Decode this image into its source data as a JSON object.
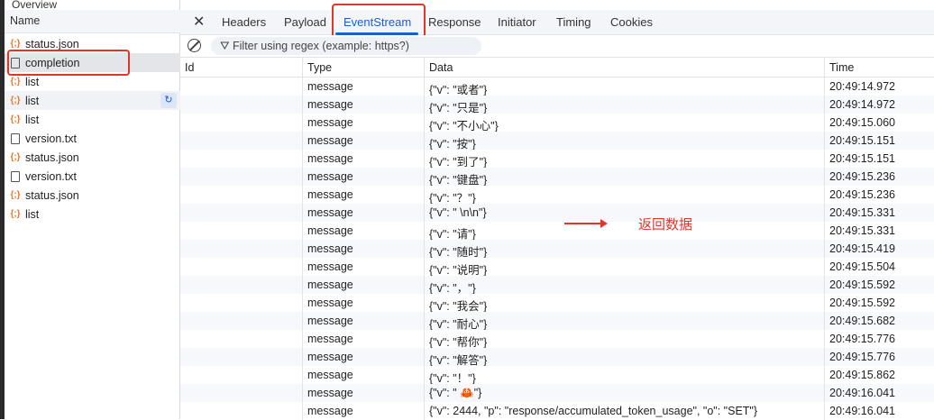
{
  "left": {
    "overview": "Overview",
    "name_header": "Name",
    "items": [
      {
        "label": "status.json",
        "icon": "json-icon"
      },
      {
        "label": "completion",
        "icon": "document-icon"
      },
      {
        "label": "list",
        "icon": "json-icon"
      },
      {
        "label": "list",
        "icon": "json-icon"
      },
      {
        "label": "list",
        "icon": "json-icon"
      },
      {
        "label": "version.txt",
        "icon": "document-icon"
      },
      {
        "label": "status.json",
        "icon": "json-icon"
      },
      {
        "label": "version.txt",
        "icon": "document-icon"
      },
      {
        "label": "status.json",
        "icon": "json-icon"
      },
      {
        "label": "list",
        "icon": "json-icon"
      }
    ]
  },
  "tabs": [
    "Headers",
    "Payload",
    "EventStream",
    "Response",
    "Initiator",
    "Timing",
    "Cookies"
  ],
  "active_tab": "EventStream",
  "filter_placeholder": "Filter using regex (example: https?)",
  "columns": [
    "Id",
    "Type",
    "Data",
    "Time"
  ],
  "rows": [
    [
      "",
      "message",
      "{\"v\": \"或者\"}",
      "20:49:14.972"
    ],
    [
      "",
      "message",
      "{\"v\": \"只是\"}",
      "20:49:14.972"
    ],
    [
      "",
      "message",
      "{\"v\": \"不小心\"}",
      "20:49:15.060"
    ],
    [
      "",
      "message",
      "{\"v\": \"按\"}",
      "20:49:15.151"
    ],
    [
      "",
      "message",
      "{\"v\": \"到了\"}",
      "20:49:15.151"
    ],
    [
      "",
      "message",
      "{\"v\": \"键盘\"}",
      "20:49:15.236"
    ],
    [
      "",
      "message",
      "{\"v\": \"？\"}",
      "20:49:15.236"
    ],
    [
      "",
      "message",
      "{\"v\": \" \\n\\n\"}",
      "20:49:15.331"
    ],
    [
      "",
      "message",
      "{\"v\": \"请\"}",
      "20:49:15.331"
    ],
    [
      "",
      "message",
      "{\"v\": \"随时\"}",
      "20:49:15.419"
    ],
    [
      "",
      "message",
      "{\"v\": \"说明\"}",
      "20:49:15.504"
    ],
    [
      "",
      "message",
      "{\"v\": \"，\"}",
      "20:49:15.592"
    ],
    [
      "",
      "message",
      "{\"v\": \"我会\"}",
      "20:49:15.592"
    ],
    [
      "",
      "message",
      "{\"v\": \"耐心\"}",
      "20:49:15.682"
    ],
    [
      "",
      "message",
      "{\"v\": \"帮你\"}",
      "20:49:15.776"
    ],
    [
      "",
      "message",
      "{\"v\": \"解答\"}",
      "20:49:15.776"
    ],
    [
      "",
      "message",
      "{\"v\": \"！\"}",
      "20:49:15.862"
    ],
    [
      "",
      "message",
      "{\"v\": \" 🦀\"}",
      "20:49:16.041"
    ],
    [
      "",
      "message",
      "{\"v\": 2444, \"p\": \"response/accumulated_token_usage\", \"o\": \"SET\"}",
      "20:49:16.041"
    ]
  ],
  "annotation": "返回数据",
  "colors": {
    "accent": "#1a5fd0",
    "annotation": "#e0362a"
  }
}
